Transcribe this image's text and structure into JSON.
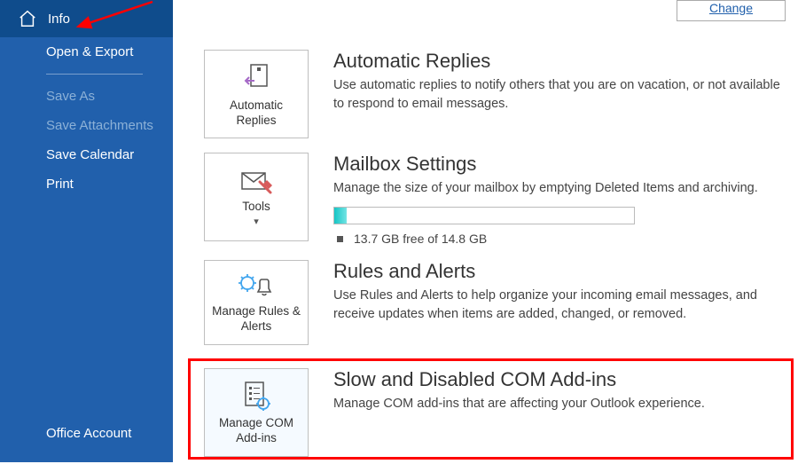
{
  "sidebar": {
    "info": "Info",
    "open_export": "Open & Export",
    "save_as": "Save As",
    "save_attachments": "Save Attachments",
    "save_calendar": "Save Calendar",
    "print": "Print",
    "office_account": "Office Account"
  },
  "change_link": "Change",
  "sections": {
    "auto": {
      "tile": "Automatic Replies",
      "title": "Automatic Replies",
      "body": "Use automatic replies to notify others that you are on vacation, or not available to respond to email messages."
    },
    "tools": {
      "tile": "Tools",
      "title": "Mailbox Settings",
      "body": "Manage the size of your mailbox by emptying Deleted Items and archiving.",
      "meter_text": "13.7 GB free of 14.8 GB"
    },
    "rules": {
      "tile": "Manage Rules & Alerts",
      "title": "Rules and Alerts",
      "body": "Use Rules and Alerts to help organize your incoming email messages, and receive updates when items are added, changed, or removed."
    },
    "com": {
      "tile": "Manage COM Add-ins",
      "title": "Slow and Disabled COM Add-ins",
      "body": "Manage COM add-ins that are affecting your Outlook experience."
    }
  }
}
